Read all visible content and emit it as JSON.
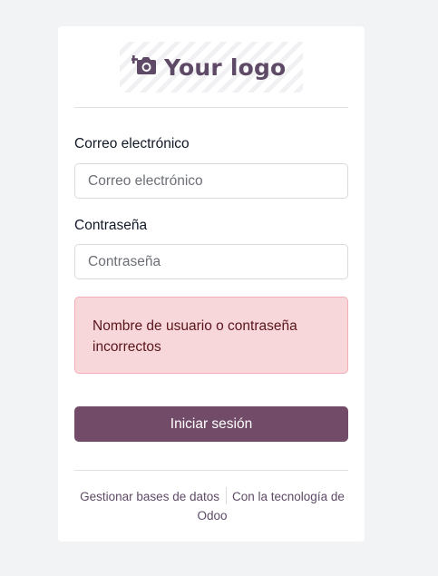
{
  "logo": {
    "text": "Your logo",
    "icon": "camera-plus-icon",
    "color": "#5e4a66"
  },
  "form": {
    "email_label": "Correo electrónico",
    "email_placeholder": "Correo electrónico",
    "email_value": "",
    "password_label": "Contraseña",
    "password_placeholder": "Contraseña",
    "password_value": ""
  },
  "alert": {
    "message": "Nombre de usuario o contraseña incorrectos",
    "background": "#f8d7da",
    "text_color": "#58151c"
  },
  "login_button": {
    "label": "Iniciar sesión",
    "color": "#714b67"
  },
  "footer": {
    "manage_db_link": "Gestionar bases de datos",
    "powered_by_text": "Con la tecnología de",
    "odoo_link": "Odoo"
  }
}
